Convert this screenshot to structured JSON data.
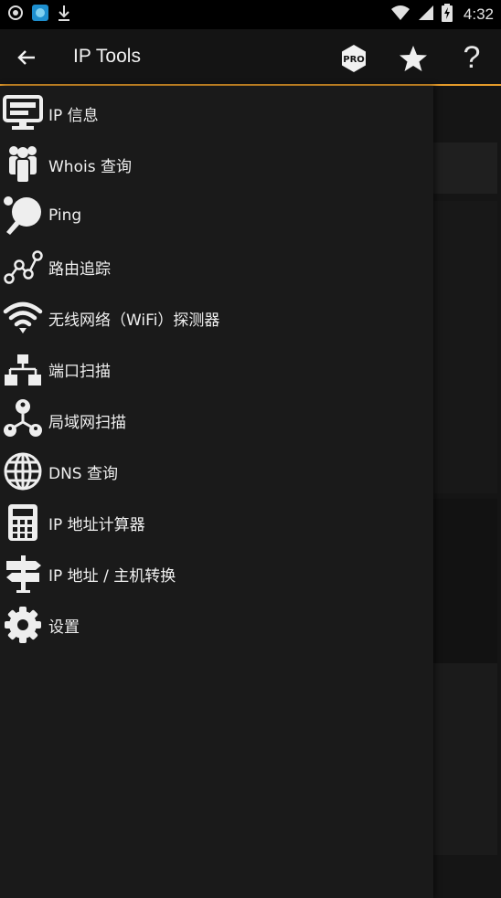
{
  "status_bar": {
    "time": "4:32",
    "left_icons": [
      "target-icon",
      "app-notification-icon",
      "download-icon"
    ],
    "right_icons": [
      "wifi-icon",
      "signal-icon",
      "battery-charging-icon"
    ]
  },
  "app_bar": {
    "title": "IP Tools",
    "back_icon": "back-arrow-icon",
    "pro_badge": "PRO",
    "help_label": "?",
    "accent_color": "#e39a2a"
  },
  "drawer": {
    "items": [
      {
        "label": "IP 信息",
        "icon": "monitor-icon"
      },
      {
        "label": "Whois 查询",
        "icon": "people-icon"
      },
      {
        "label": "Ping",
        "icon": "ping-pong-icon"
      },
      {
        "label": "路由追踪",
        "icon": "route-graph-icon"
      },
      {
        "label": "无线网络（WiFi）探测器",
        "icon": "wifi-icon"
      },
      {
        "label": "端口扫描",
        "icon": "network-ports-icon"
      },
      {
        "label": "局域网扫描",
        "icon": "lan-people-icon"
      },
      {
        "label": "DNS 查询",
        "icon": "globe-icon"
      },
      {
        "label": "IP 地址计算器",
        "icon": "calculator-icon"
      },
      {
        "label": "IP 地址 / 主机转换",
        "icon": "signpost-icon"
      },
      {
        "label": "设置",
        "icon": "gear-icon"
      }
    ]
  }
}
